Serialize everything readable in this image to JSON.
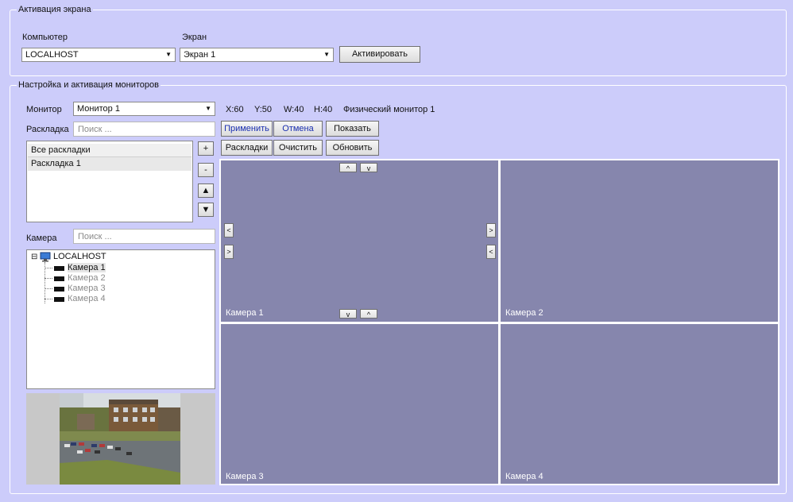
{
  "screen_activation": {
    "legend": "Активация экрана",
    "computer_label": "Компьютер",
    "computer_value": "LOCALHOST",
    "screen_label": "Экран",
    "screen_value": "Экран 1",
    "activate_button": "Активировать"
  },
  "monitors": {
    "legend": "Настройка и активация мониторов",
    "monitor_label": "Монитор",
    "monitor_value": "Монитор 1",
    "coords": {
      "x": "X:60",
      "y": "Y:50",
      "w": "W:40",
      "h": "H:40"
    },
    "physical_monitor": "Физический монитор 1",
    "layout_label": "Раскладка",
    "layout_search_placeholder": "Поиск ...",
    "buttons": {
      "apply": "Применить",
      "cancel": "Отмена",
      "show": "Показать",
      "layouts": "Раскладки",
      "clear": "Очистить",
      "refresh": "Обновить"
    },
    "layout_list": [
      "Все раскладки",
      "Раскладка 1"
    ],
    "list_buttons": {
      "add": "+",
      "remove": "-"
    },
    "camera_label": "Камера",
    "camera_search_placeholder": "Поиск ...",
    "tree": {
      "root": "LOCALHOST",
      "expander": "⊟",
      "cameras": [
        "Камера 1",
        "Камера 2",
        "Камера 3",
        "Камера 4"
      ]
    },
    "grid": {
      "cells": [
        "Камера 1",
        "Камера 2",
        "Камера 3",
        "Камера 4"
      ],
      "move_up": "^",
      "move_down": "v",
      "move_left": "<",
      "move_right": ">"
    }
  },
  "colors": {
    "background": "#ccccfa",
    "cell": "#8686ad"
  }
}
